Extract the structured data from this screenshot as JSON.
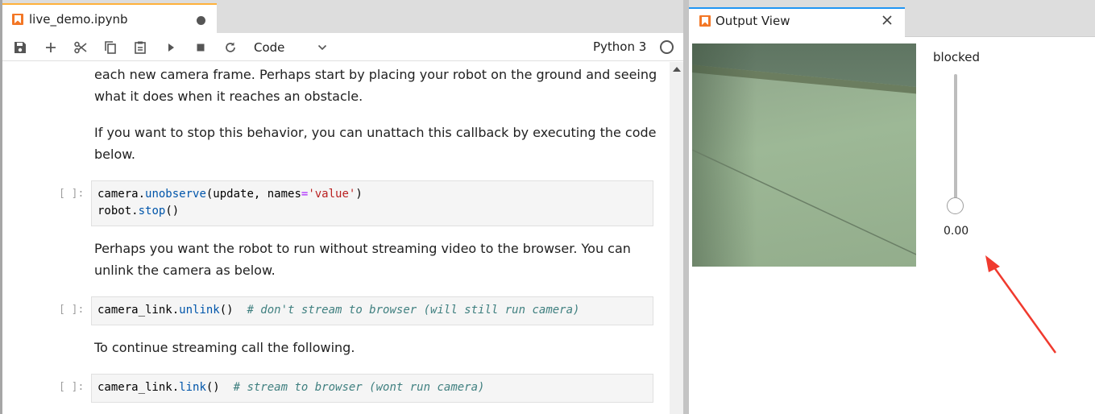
{
  "notebook": {
    "tab_title": "live_demo.ipynb",
    "toolbar": {
      "buttons": [
        "save-icon",
        "add-cell-icon",
        "cut-icon",
        "copy-icon",
        "paste-icon",
        "run-icon",
        "stop-icon",
        "restart-icon"
      ],
      "cell_type": "Code",
      "kernel_name": "Python 3"
    },
    "cells": {
      "md1_line1": "each new camera frame. Perhaps start by placing your robot on the ground and seeing",
      "md1_line2": "what it does when it reaches an obstacle.",
      "md2_line1": "If you want to stop this behavior, you can unattach this callback by executing the code",
      "md2_line2": "below.",
      "code1_prompt": "[ ]:",
      "code1": {
        "l1_obj": "camera",
        "l1_dot": ".",
        "l1_method": "unobserve",
        "l1_args": "(update, names",
        "l1_eq": "=",
        "l1_str": "'value'",
        "l1_close": ")",
        "l2_obj": "robot",
        "l2_dot": ".",
        "l2_method": "stop",
        "l2_call": "()"
      },
      "md3_line1": "Perhaps you want the robot to run without streaming video to the browser. You can",
      "md3_line2": "unlink the camera as below.",
      "code2_prompt": "[ ]:",
      "code2": {
        "obj": "camera_link",
        "dot": ".",
        "method": "unlink",
        "call": "()  ",
        "comment": "# don't stream to browser (will still run camera)"
      },
      "md4_line1": "To continue streaming call the following.",
      "code3_prompt": "[ ]:",
      "code3": {
        "obj": "camera_link",
        "dot": ".",
        "method": "link",
        "call": "()  ",
        "comment": "# stream to browser (wont run camera)"
      }
    }
  },
  "output_view": {
    "tab_title": "Output View",
    "slider": {
      "label": "blocked",
      "value": "0.00",
      "level": 0.0
    }
  },
  "colors": {
    "notebook_tab_accent": "#ffb13b",
    "output_tab_accent": "#2196f3",
    "annotation_arrow": "#f03a2e"
  }
}
